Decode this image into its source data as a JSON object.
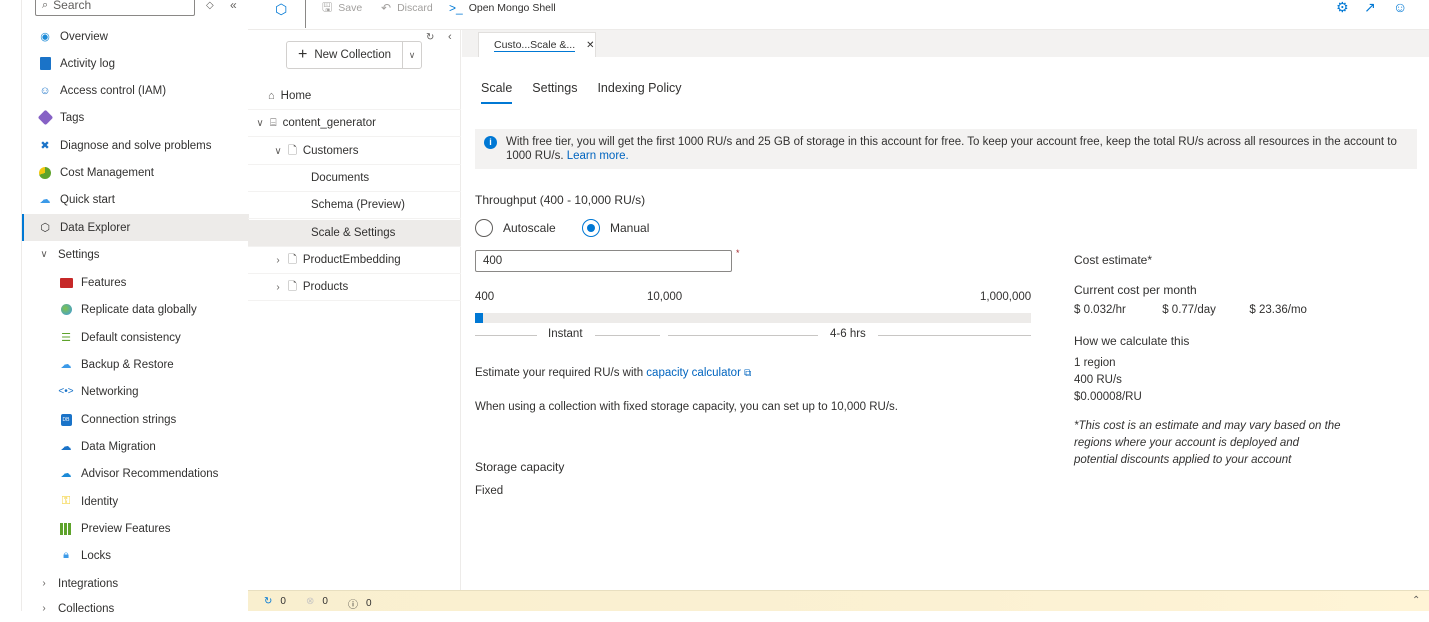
{
  "nav": {
    "search_placeholder": "Search",
    "items": [
      {
        "label": "Overview",
        "icon": "cosmos-overview-icon"
      },
      {
        "label": "Activity log",
        "icon": "activity-log-icon"
      },
      {
        "label": "Access control (IAM)",
        "icon": "iam-people-icon"
      },
      {
        "label": "Tags",
        "icon": "tag-icon"
      },
      {
        "label": "Diagnose and solve problems",
        "icon": "wrench-icon"
      },
      {
        "label": "Cost Management",
        "icon": "cost-management-icon"
      },
      {
        "label": "Quick start",
        "icon": "cloud-icon"
      },
      {
        "label": "Data Explorer",
        "icon": "cube-icon",
        "selected": true
      },
      {
        "label": "Settings",
        "icon": "chevron-down-icon",
        "expanded": true
      },
      {
        "label": "Features",
        "icon": "toolbox-icon"
      },
      {
        "label": "Replicate data globally",
        "icon": "globe-icon"
      },
      {
        "label": "Default consistency",
        "icon": "lines-icon"
      },
      {
        "label": "Backup & Restore",
        "icon": "cloud-backup-icon"
      },
      {
        "label": "Networking",
        "icon": "network-icon"
      },
      {
        "label": "Connection strings",
        "icon": "db-icon"
      },
      {
        "label": "Data Migration",
        "icon": "migration-icon"
      },
      {
        "label": "Advisor Recommendations",
        "icon": "advisor-icon"
      },
      {
        "label": "Identity",
        "icon": "key-icon"
      },
      {
        "label": "Preview Features",
        "icon": "grid-icon"
      },
      {
        "label": "Locks",
        "icon": "lock-icon"
      },
      {
        "label": "Integrations",
        "icon": "chevron-right-icon"
      },
      {
        "label": "Collections",
        "icon": "chevron-right-icon"
      }
    ]
  },
  "toolbar": {
    "save": "Save",
    "discard": "Discard",
    "open_shell": "Open Mongo Shell"
  },
  "tree": {
    "new_collection": "New Collection",
    "home": "Home",
    "database": "content_generator",
    "collection": "Customers",
    "documents": "Documents",
    "schema": "Schema (Preview)",
    "scale_settings": "Scale & Settings",
    "product_embedding": "ProductEmbedding",
    "products": "Products"
  },
  "doc_tab": {
    "label": "Custo...Scale &..."
  },
  "subtabs": [
    "Scale",
    "Settings",
    "Indexing Policy"
  ],
  "info": {
    "text": "With free tier, you will get the first 1000 RU/s and 25 GB of storage in this account for free. To keep your account free, keep the total RU/s across all resources in the account to 1000 RU/s.",
    "link": "Learn more."
  },
  "throughput": {
    "label": "Throughput (400 - 10,000 RU/s)",
    "autoscale": "Autoscale",
    "manual": "Manual",
    "selected_mode": "Manual",
    "value": "400",
    "required_mark": "*",
    "scale_min": "400",
    "scale_mid": "10,000",
    "scale_max": "1,000,000",
    "slider_fraction": 0.015,
    "instant": "Instant",
    "hours": "4-6 hrs",
    "estimate_prefix": "Estimate your required RU/s with",
    "calculator_link": "capacity calculator",
    "fixed_note": "When using a collection with fixed storage capacity, you can set up to 10,000 RU/s."
  },
  "storage": {
    "label": "Storage capacity",
    "value": "Fixed"
  },
  "cost": {
    "title": "Cost estimate*",
    "current_label": "Current cost per month",
    "hourly": "$ 0.032/hr",
    "daily": "$ 0.77/day",
    "monthly": "$ 23.36/mo",
    "how_label": "How we calculate this",
    "regions": "1 region",
    "rus": "400 RU/s",
    "rate": "$0.00008/RU",
    "disclaimer": "*This cost is an estimate and may vary based on the regions where your account is deployed and potential discounts applied to your account"
  },
  "status": {
    "in_progress": "0",
    "errors": "0",
    "info": "0"
  }
}
